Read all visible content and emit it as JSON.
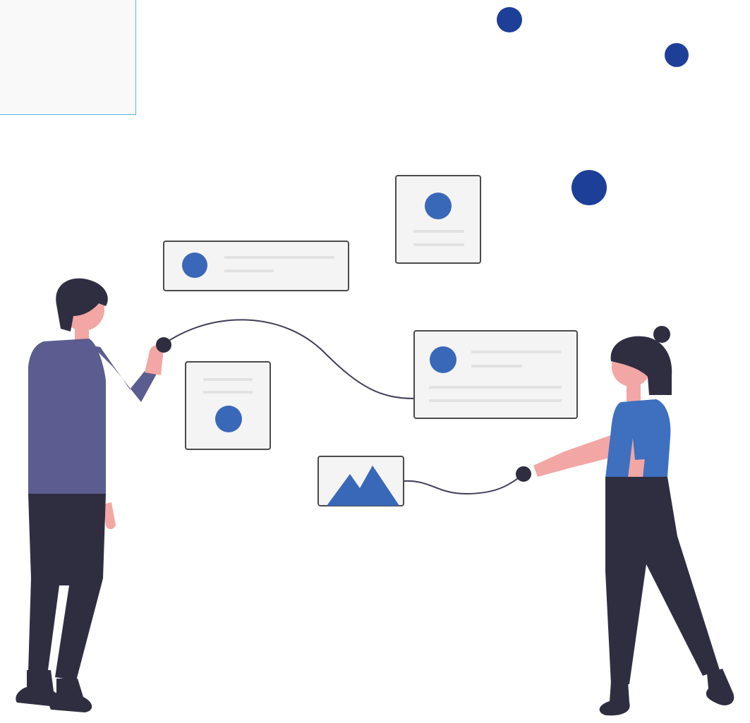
{
  "illustration": {
    "subject": "",
    "colors": {
      "accent_dark": "#1e3f98",
      "accent": "#3a68b8",
      "card_fill": "#f4f4f4",
      "card_stroke": "#4a4a4a",
      "line_gray": "#e2e2e2",
      "hair": "#2f2e41",
      "skin": "#f2a7a4",
      "shirt_man": "#5b5c8f",
      "shirt_woman": "#3f6fbf",
      "pants": "#2f2e41",
      "panel_bg": "#f9f9f9",
      "panel_border": "#5ab7dc"
    }
  }
}
